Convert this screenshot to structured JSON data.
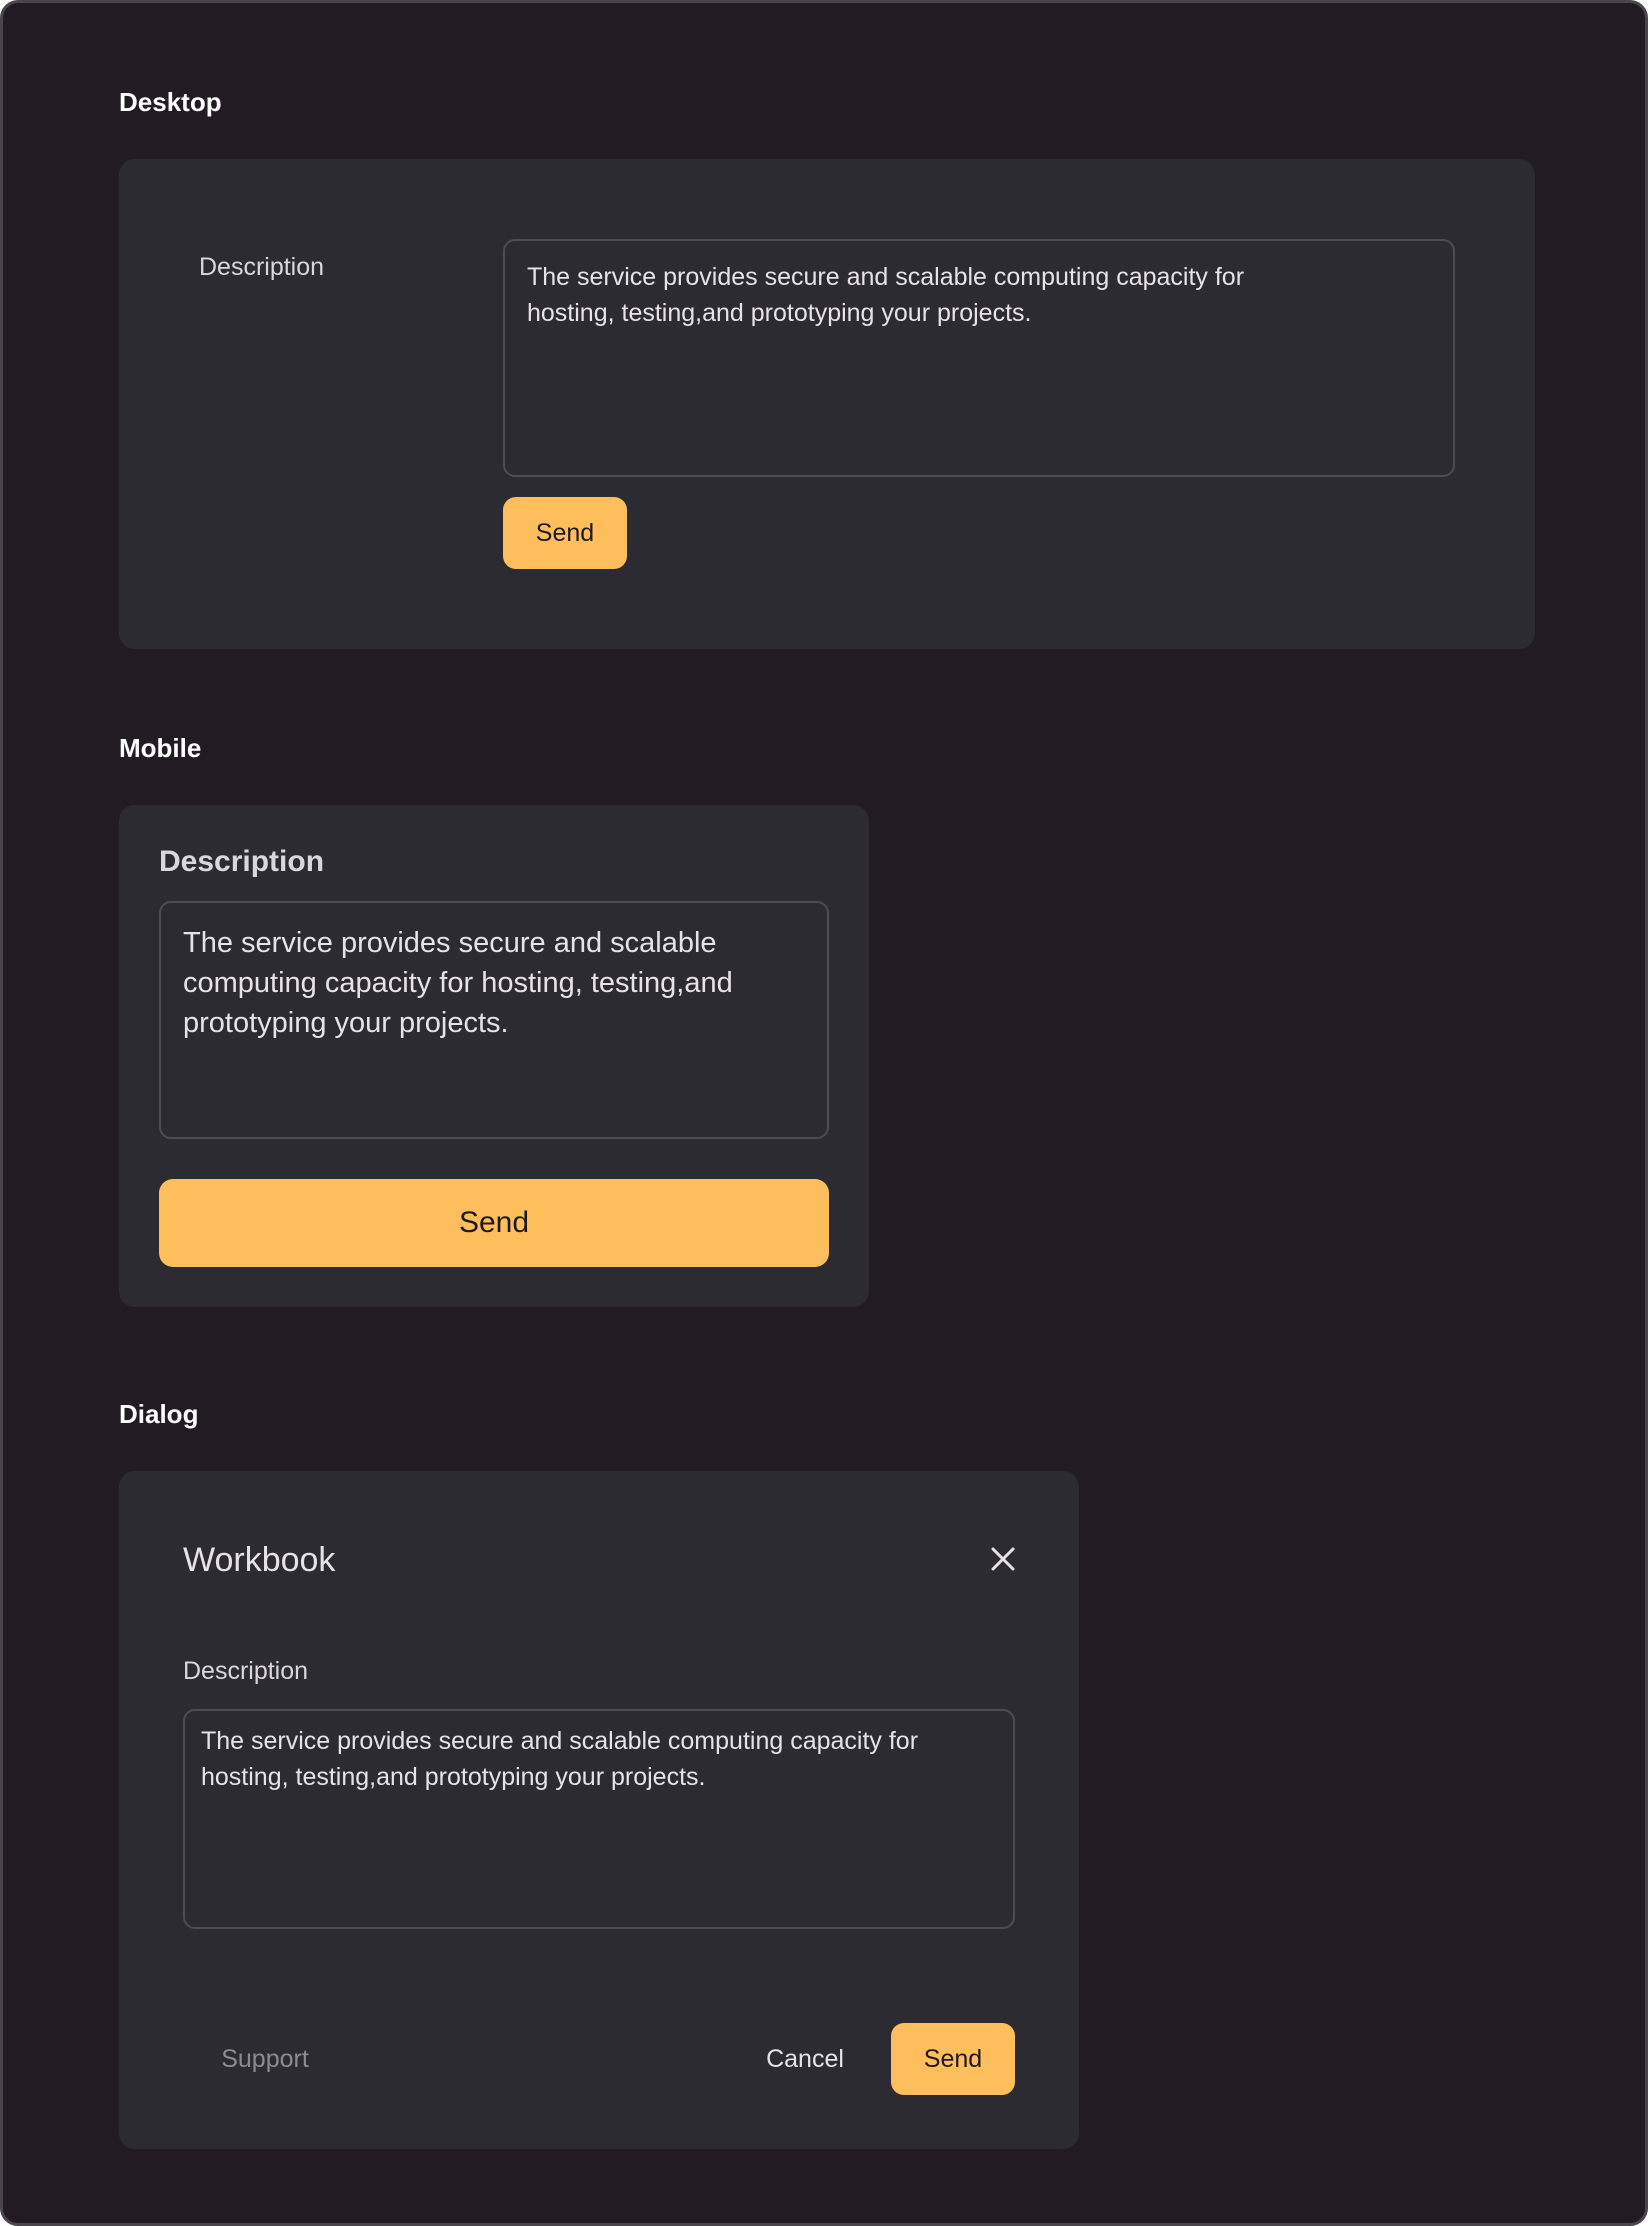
{
  "sections": {
    "desktop": {
      "title": "Desktop",
      "label": "Description",
      "textarea_value": "The service provides secure and scalable computing capacity for hosting, testing,and prototyping your projects.",
      "send_label": "Send"
    },
    "mobile": {
      "title": "Mobile",
      "label": "Description",
      "textarea_value": "The service provides secure and scalable computing capacity for hosting, testing,and prototyping your projects.",
      "send_label": "Send"
    },
    "dialog": {
      "title": "Dialog",
      "dialog_title": "Workbook",
      "close_icon": "close-icon",
      "label": "Description",
      "textarea_value": "The service provides secure and scalable computing capacity for hosting, testing,and prototyping your projects.",
      "support_label": "Support",
      "cancel_label": "Cancel",
      "send_label": "Send"
    }
  },
  "colors": {
    "background": "#231b23",
    "card": "#2c2b31",
    "accent": "#ffbe5c",
    "text": "#e6e3e8",
    "muted": "#8d8a91"
  }
}
